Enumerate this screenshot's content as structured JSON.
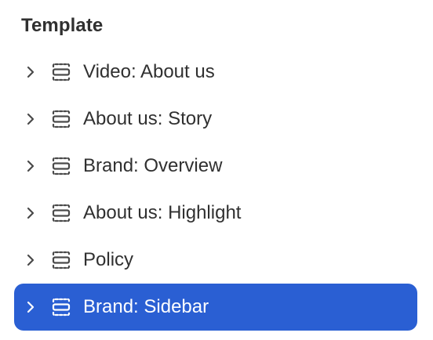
{
  "panel": {
    "title": "Template"
  },
  "tree": {
    "items": [
      {
        "label": "Video: About us",
        "icon": "section-icon",
        "expander": "chevron-right-icon",
        "selected": false
      },
      {
        "label": "About us: Story",
        "icon": "section-icon",
        "expander": "chevron-right-icon",
        "selected": false
      },
      {
        "label": "Brand: Overview",
        "icon": "section-icon",
        "expander": "chevron-right-icon",
        "selected": false
      },
      {
        "label": "About us: Highlight",
        "icon": "section-icon",
        "expander": "chevron-right-icon",
        "selected": false
      },
      {
        "label": "Policy",
        "icon": "section-icon",
        "expander": "chevron-right-icon",
        "selected": false
      },
      {
        "label": "Brand: Sidebar",
        "icon": "section-icon",
        "expander": "chevron-right-icon",
        "selected": true
      }
    ]
  },
  "colors": {
    "selected_background": "#2a5fd3",
    "selected_text": "#ffffff",
    "text": "#303030",
    "icon": "#4a4a4a"
  }
}
